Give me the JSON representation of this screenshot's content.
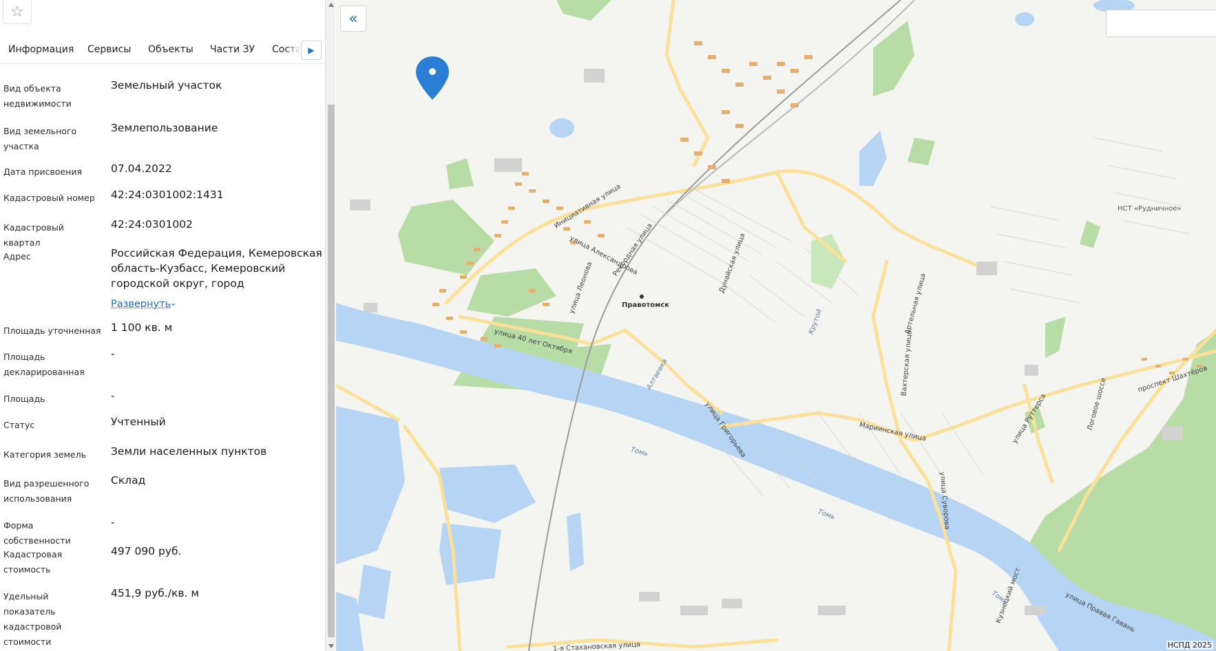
{
  "panel": {
    "tabs": [
      {
        "label": "Информация",
        "active": true
      },
      {
        "label": "Сервисы"
      },
      {
        "label": "Объекты"
      },
      {
        "label": "Части ЗУ"
      },
      {
        "label": "Состав"
      }
    ],
    "fields": [
      {
        "label": "Вид объекта недвижимости",
        "value": "Земельный участок"
      },
      {
        "label": "Вид земельного участка",
        "value": "Землепользование"
      },
      {
        "label": "Дата присвоения",
        "value": "07.04.2022"
      },
      {
        "label": "Кадастровый номер",
        "value": "42:24:0301002:1431"
      },
      {
        "label": "Кадастровый квартал",
        "value": "42:24:0301002"
      },
      {
        "label": "Адрес",
        "value": "Российская Федерация, Кемеровская область-Кузбасс, Кемеровский городской округ, город"
      },
      {
        "label": "Площадь уточненная",
        "value": "1 100 кв. м"
      },
      {
        "label": "Площадь декларированная",
        "value": "-"
      },
      {
        "label": "Площадь",
        "value": "-"
      },
      {
        "label": "Статус",
        "value": "Учтенный"
      },
      {
        "label": "Категория земель",
        "value": "Земли населенных пунктов"
      },
      {
        "label": "Вид разрешенного использования",
        "value": "Склад"
      },
      {
        "label": "Форма собственности",
        "value": "-"
      },
      {
        "label": "Кадастровая стоимость",
        "value": "497 090 руб."
      },
      {
        "label": "Удельный показатель кадастровой стоимости",
        "value": "451,9 руб./кв. м"
      }
    ],
    "expand_label": "Развернуть"
  },
  "map": {
    "attribution": "НСПД 2025",
    "labels": {
      "initsiativnaya": "Инициативная улица",
      "aleksandrova": "улица Александрова",
      "rekordnaya": "Рекордная улица",
      "leonova": "улица Леонова",
      "oktyabrya": "улица 40 лет Октября",
      "pravotomsk": "Правотомск",
      "dunayskaya": "Дунайская улица",
      "krutoy": "Крутой",
      "altaevka": "Алтаевка",
      "grigoryeva": "улица Григорьева",
      "tom1": "Томь",
      "tom2": "Томь",
      "tom3": "Томь",
      "mariinskaya": "Мариинская улица",
      "artelnaya": "Артельная улица",
      "vakhtorskaya": "Вахтерская улица",
      "suvorova": "улица Суворова",
      "ruttersa": "улица Руттерса",
      "logovoe": "Логовое шоссе",
      "shakhterov": "проспект Шахтёров",
      "kuznetsky": "Кузнецкий мост",
      "pravaya_gavan": "улица Правая Гавань",
      "stakhanovskaya": "1-я Стахановская улица",
      "nst": "НСТ «Рудничное»"
    },
    "colors": {
      "river": "#b6d4f4",
      "forest": "#aed69c",
      "road": "#fbe09a",
      "building": "#e3b072"
    }
  }
}
